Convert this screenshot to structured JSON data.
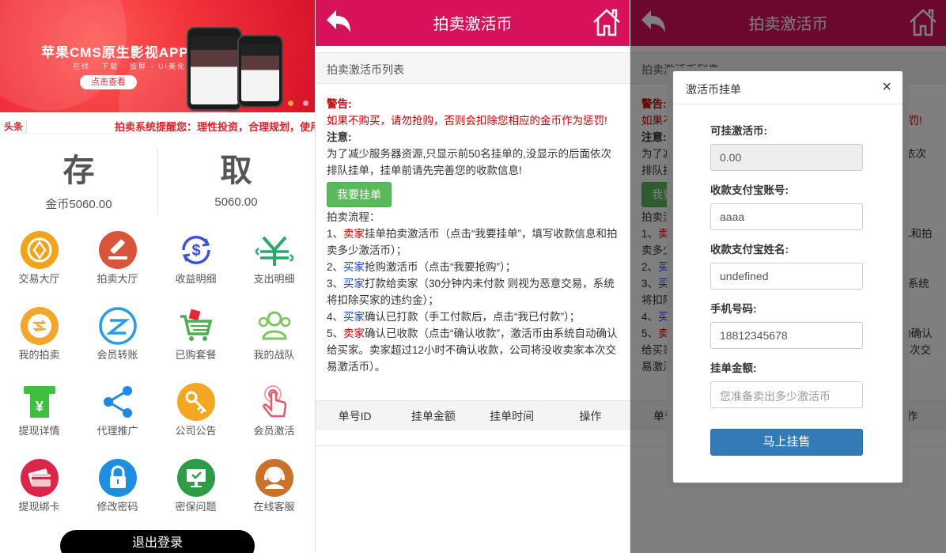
{
  "home": {
    "banner": {
      "title": "苹果CMS原生影视APP",
      "subtitle": "在线 · 下载 · 投屏 · UI美化",
      "button": "点击查看"
    },
    "notice": {
      "tag": "头条",
      "message": "拍卖系统提醒您：理性投资，合理规划，使用"
    },
    "deposit": {
      "label": "存",
      "value": "金币5060.00"
    },
    "withdraw": {
      "label": "取",
      "value": "5060.00"
    },
    "menu": [
      {
        "label": "交易大厅",
        "icon": "coin-icon",
        "color": "#f2a31b"
      },
      {
        "label": "拍卖大厅",
        "icon": "gavel-icon",
        "color": "#d9553a"
      },
      {
        "label": "收益明细",
        "icon": "dollar-refresh-icon",
        "color": "#3f51d8"
      },
      {
        "label": "支出明细",
        "icon": "yen-arrows-icon",
        "color": "#28a86f"
      },
      {
        "label": "我的拍卖",
        "icon": "transfer-coin-icon",
        "color": "#f0a72a"
      },
      {
        "label": "会员转账",
        "icon": "transfer-icon",
        "color": "#2b9be8"
      },
      {
        "label": "已购套餐",
        "icon": "shopping-cart-icon",
        "color": "#4caf50"
      },
      {
        "label": "我的战队",
        "icon": "team-icon",
        "color": "#7cc55a"
      },
      {
        "label": "提现详情",
        "icon": "atm-cash-icon",
        "color": "#3fbf3f"
      },
      {
        "label": "代理推广",
        "icon": "share-icon",
        "color": "#1e88e5"
      },
      {
        "label": "公司公告",
        "icon": "key-icon",
        "color": "#f5a623"
      },
      {
        "label": "会员激活",
        "icon": "touch-icon",
        "color": "#e9576b"
      },
      {
        "label": "提现绑卡",
        "icon": "card-icon",
        "color": "#d9264a"
      },
      {
        "label": "修改密码",
        "icon": "lock-icon",
        "color": "#1d8fe0"
      },
      {
        "label": "密保问题",
        "icon": "screen-icon",
        "color": "#2e9b46"
      },
      {
        "label": "在线客服",
        "icon": "support-icon",
        "color": "#c9732a"
      }
    ],
    "logout": "退出登录"
  },
  "auction": {
    "title": "拍卖激活币",
    "list_title": "拍卖激活币列表",
    "warning_head": "警告:",
    "warning_text": "如果不购买，请勿抢购，否则会扣除您相应的金币作为惩罚!",
    "note_head": "注意:",
    "note_text": "为了减少服务器资源,只显示前50名挂单的,没显示的后面依次排队挂单，挂单前请先完善您的收款信息!",
    "post_button": "我要挂单",
    "process_head": "拍卖流程：",
    "steps": [
      {
        "num": "1、",
        "role": "卖家",
        "role_color": "red",
        "text": "挂单拍卖激活币（点击“我要挂单”，填写收款信息和拍卖多少激活币）；"
      },
      {
        "num": "2、",
        "role": "买家",
        "role_color": "blue",
        "text": "抢购激活币（点击“我要抢购”）；"
      },
      {
        "num": "3、",
        "role": "买家",
        "role_color": "blue",
        "text": "打款给卖家（30分钟内未付款 则视为恶意交易，系统将扣除买家的违约金）；"
      },
      {
        "num": "4、",
        "role": "买家",
        "role_color": "blue",
        "text": "确认已打款（手工付款后，点击“我已付款”）；"
      },
      {
        "num": "5、",
        "role": "卖家",
        "role_color": "red",
        "text": "确认已收款（点击“确认收款”，激活币由系统自动确认给买家。卖家超过12小时不确认收款，公司将没收卖家本次交易激活币）。"
      }
    ],
    "columns": [
      "单号ID",
      "挂单金额",
      "挂单时间",
      "操作"
    ]
  },
  "modal": {
    "title": "激活币挂单",
    "close": "×",
    "fields": [
      {
        "label": "可挂激活币:",
        "value": "0.00",
        "disabled": true
      },
      {
        "label": "收款支付宝账号:",
        "value": "aaaa"
      },
      {
        "label": "收款支付宝姓名:",
        "value": "undefined"
      },
      {
        "label": "手机号码:",
        "value": "18812345678"
      },
      {
        "label": "挂单金额:",
        "placeholder": "您准备卖出多少激活币"
      }
    ],
    "submit": "马上挂售"
  }
}
